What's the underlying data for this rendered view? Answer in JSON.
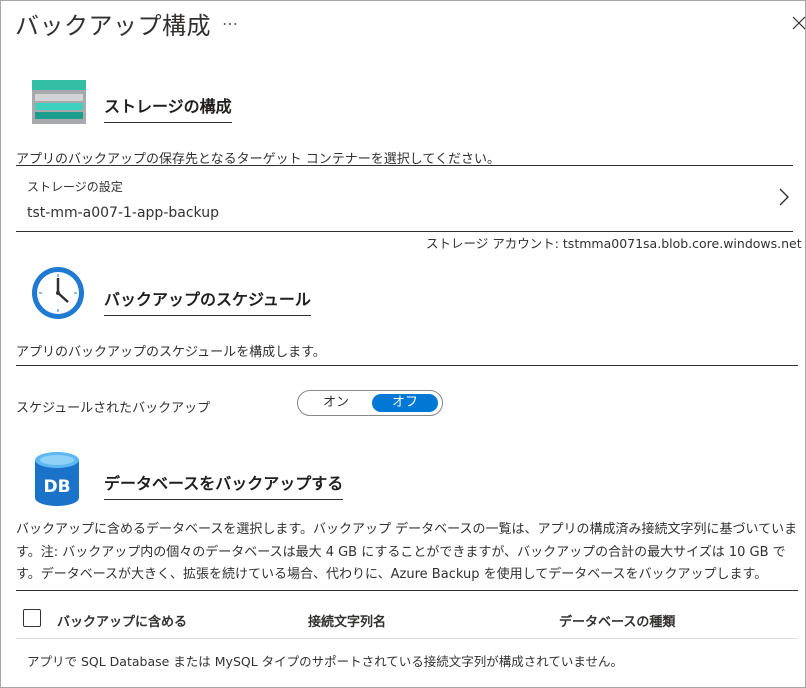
{
  "header": {
    "title": "バックアップ構成",
    "more_label": "…"
  },
  "storage": {
    "section_title": "ストレージの構成",
    "description": "アプリのバックアップの保存先となるターゲット コンテナーを選択してください。",
    "setting_label": "ストレージの設定",
    "setting_value": "tst-mm-a007-1-app-backup",
    "account_text": "ストレージ アカウント: tstmma0071sa.blob.core.windows.net"
  },
  "schedule": {
    "section_title": "バックアップのスケジュール",
    "description": "アプリのバックアップのスケジュールを構成します。",
    "toggle_label": "スケジュールされたバックアップ",
    "toggle_on": "オン",
    "toggle_off": "オフ",
    "toggle_selected": "オフ"
  },
  "database": {
    "section_title": "データベースをバックアップする",
    "paragraph_lines": [
      "バックアップに含めるデータベースを選択します。バックアップ データベースの一覧は、アプリの構成済み接続文字列に基づいていま",
      "す。注: バックアップ内の個々のデータベースは最大 4 GB にすることができますが、バックアップの合計の最大サイズは 10 GB で",
      "す。データベースが大きく、拡張を続けている場合、代わりに、Azure Backup を使用してデータベースをバックアップします。"
    ],
    "table": {
      "col_include": "バックアップに含める",
      "col_connection": "接続文字列名",
      "col_type": "データベースの種類"
    },
    "empty_message": "アプリで SQL Database または MySQL タイプのサポートされている接続文字列が構成されていません。"
  },
  "colors": {
    "accent": "#0078d4",
    "text": "#323130"
  }
}
